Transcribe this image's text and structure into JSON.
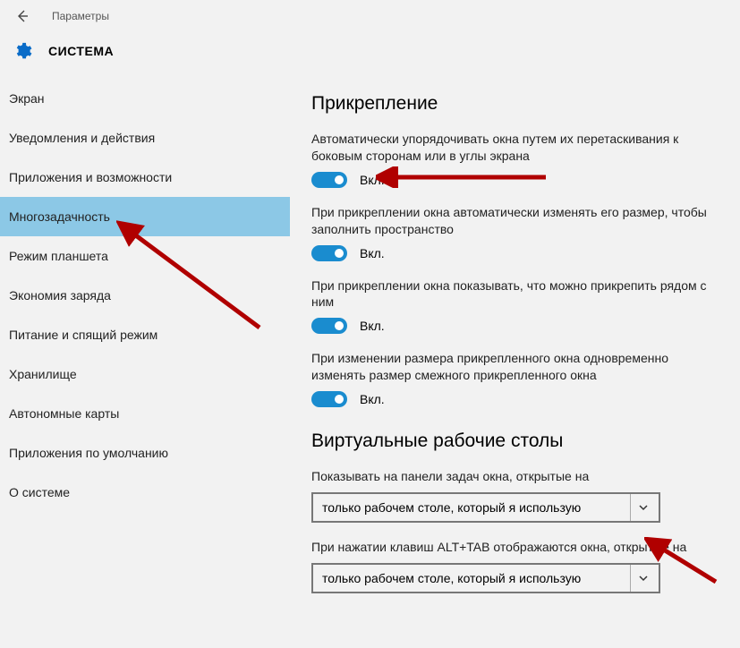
{
  "titlebar": {
    "label": "Параметры"
  },
  "header": {
    "title": "СИСТЕМА"
  },
  "sidebar": {
    "items": [
      {
        "label": "Экран"
      },
      {
        "label": "Уведомления и действия"
      },
      {
        "label": "Приложения и возможности"
      },
      {
        "label": "Многозадачность",
        "selected": true
      },
      {
        "label": "Режим планшета"
      },
      {
        "label": "Экономия заряда"
      },
      {
        "label": "Питание и спящий режим"
      },
      {
        "label": "Хранилище"
      },
      {
        "label": "Автономные карты"
      },
      {
        "label": "Приложения по умолчанию"
      },
      {
        "label": "О системе"
      }
    ]
  },
  "main": {
    "section1_title": "Прикрепление",
    "settings": [
      {
        "desc": "Автоматически упорядочивать окна путем их перетаскивания к боковым сторонам или в углы экрана",
        "state": "Вкл."
      },
      {
        "desc": "При прикреплении окна автоматически изменять его размер, чтобы заполнить пространство",
        "state": "Вкл."
      },
      {
        "desc": "При прикреплении окна показывать, что можно прикрепить рядом с ним",
        "state": "Вкл."
      },
      {
        "desc": "При изменении размера прикрепленного окна одновременно изменять размер смежного прикрепленного окна",
        "state": "Вкл."
      }
    ],
    "section2_title": "Виртуальные рабочие столы",
    "dd1_label": "Показывать на панели задач окна, открытые на",
    "dd1_value": "только рабочем столе, который я использую",
    "dd2_label": "При нажатии клавиш ALT+TAB отображаются окна, открытые на",
    "dd2_value": "только рабочем столе, который я использую"
  }
}
